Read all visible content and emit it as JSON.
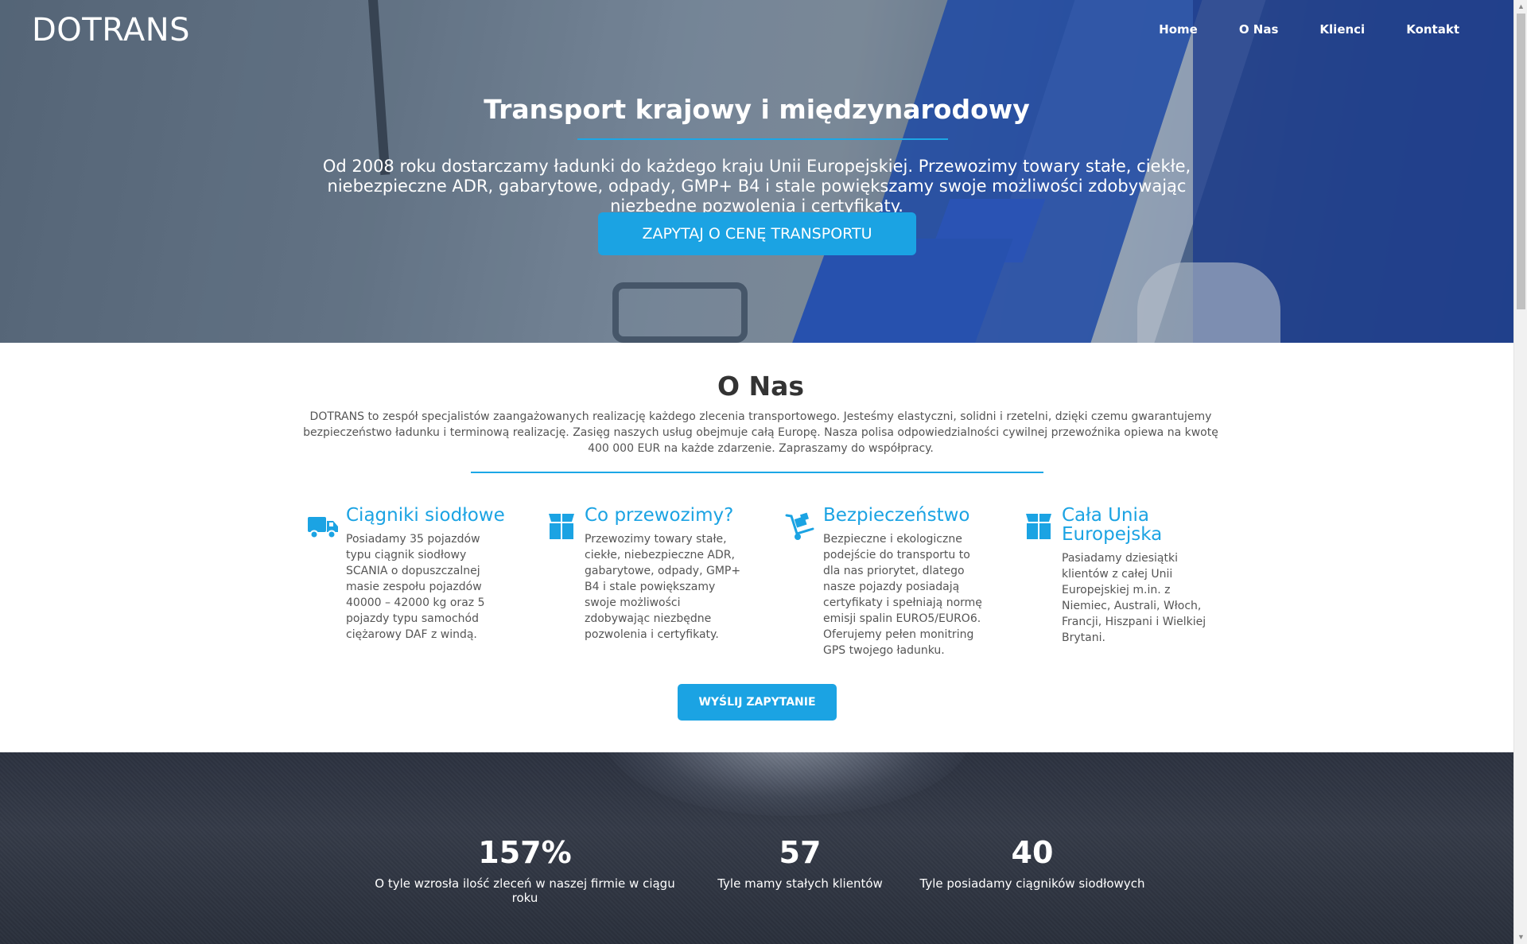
{
  "header": {
    "logo": "DOTRANS",
    "nav": [
      "Home",
      "O Nas",
      "Klienci",
      "Kontakt"
    ]
  },
  "hero": {
    "title": "Transport krajowy i międzynarodowy",
    "text": "Od 2008 roku dostarczamy ładunki do każdego kraju Unii Europejskiej. Przewozimy towary stałe, ciekłe, niebezpieczne ADR, gabarytowe, odpady, GMP+ B4 i stale powiększamy swoje możliwości zdobywając niezbędne pozwolenia i certyfikaty.",
    "button": "ZAPYTAJ O CENĘ TRANSPORTU"
  },
  "about": {
    "title": "O Nas",
    "text": "DOTRANS to zespół specjalistów zaangażowanych realizację każdego zlecenia transportowego. Jesteśmy elastyczni, solidni i rzetelni, dzięki czemu gwarantujemy bezpieczeństwo ładunku i terminową realizację. Zasięg naszych usług obejmuje całą Europę. Nasza polisa odpowiedzialności cywilnej przewoźnika opiewa na kwotę 400 000 EUR na każde zdarzenie. Zapraszamy do współpracy.",
    "features": [
      {
        "icon": "truck-icon",
        "title": "Ciągniki siodłowe",
        "text": "Posiadamy 35 pojazdów typu ciągnik siodłowy SCANIA o dopuszczalnej masie zespołu pojazdów 40000 – 42000 kg oraz 5 pojazdy typu samochód ciężarowy DAF z windą."
      },
      {
        "icon": "box-icon",
        "title": "Co przewozimy?",
        "text": "Przewozimy towary stałe, ciekłe, niebezpieczne ADR, gabarytowe, odpady, GMP+ B4 i stale powiększamy swoje możliwości zdobywając niezbędne pozwolenia i certyfikaty."
      },
      {
        "icon": "hand-truck-icon",
        "title": "Bezpieczeństwo",
        "text": "Bezpieczne i ekologiczne podejście do transportu to dla nas priorytet, dlatego nasze pojazdy posiadają certyfikaty i spełniają normę emisji spalin EURO5/EURO6. Oferujemy pełen monitring GPS twojego ładunku."
      },
      {
        "icon": "box-icon",
        "title": "Cała Unia Europejska",
        "text": "Pasiadamy dziesiątki klientów z całej Unii Europejskiej m.in. z Niemiec, Australi, Włoch, Francji, Hiszpani i Wielkiej Brytani."
      }
    ],
    "button": "WYŚLIJ ZAPYTANIE"
  },
  "stats": [
    {
      "value": "157%",
      "label": "O tyle wzrosła ilość zleceń w naszej firmie w ciągu roku"
    },
    {
      "value": "57",
      "label": "Tyle mamy stałych klientów"
    },
    {
      "value": "40",
      "label": "Tyle posiadamy ciągników siodłowych"
    }
  ],
  "colors": {
    "accent": "#1ba3e3"
  }
}
